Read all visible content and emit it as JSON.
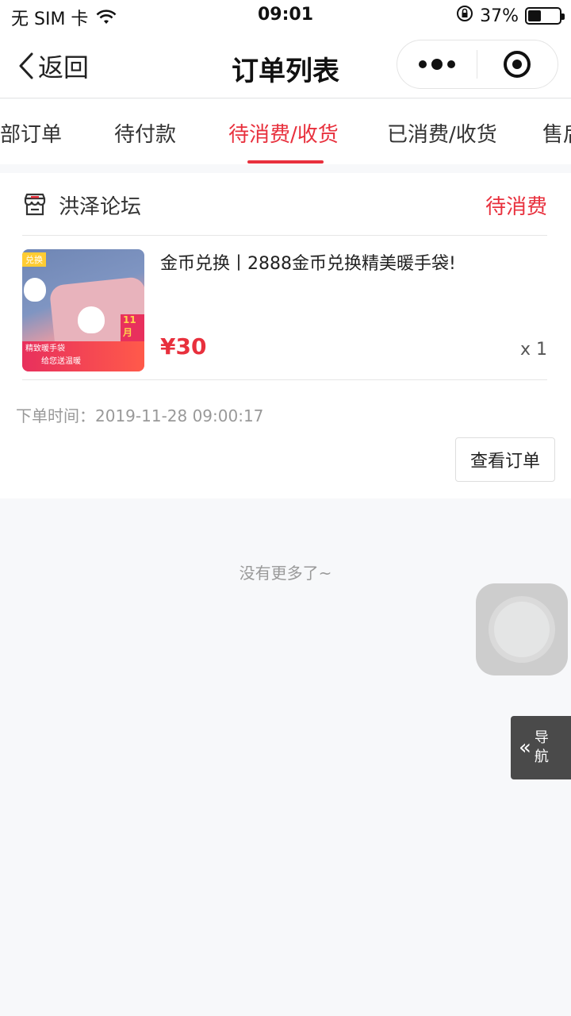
{
  "status_bar": {
    "carrier": "无 SIM 卡",
    "time": "09:01",
    "battery": "37%"
  },
  "header": {
    "back_label": "返回",
    "title": "订单列表"
  },
  "tabs": [
    {
      "label": "部订单"
    },
    {
      "label": "待付款"
    },
    {
      "label": "待消费/收货"
    },
    {
      "label": "已消费/收货"
    },
    {
      "label": "售后"
    }
  ],
  "order": {
    "shop_name": "洪泽论坛",
    "status": "待消费",
    "product_title": "金币兑换丨2888金币兑换精美暖手袋!",
    "price": "¥30",
    "quantity": "x 1",
    "order_time": "下单时间：2019-11-28 09:00:17",
    "view_button": "查看订单",
    "thumbnail": {
      "tag": "兑换",
      "banner_line1": "精致暖手袋",
      "banner_line2": "给您送温暖",
      "badge": "11月"
    }
  },
  "footer": {
    "no_more": "没有更多了~"
  },
  "side_nav": {
    "label": "导航"
  },
  "colors": {
    "accent": "#e8303d",
    "background": "#f7f8fa"
  }
}
